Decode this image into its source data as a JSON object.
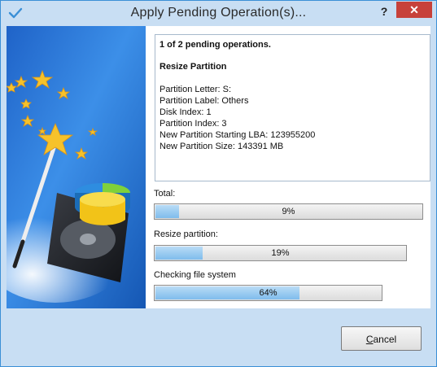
{
  "window": {
    "title": "Apply Pending Operation(s)...",
    "help_label": "?",
    "close_label": "✕"
  },
  "info": {
    "summary": "1 of 2 pending operations.",
    "operation": "Resize Partition",
    "details": [
      "Partition Letter: S:",
      "Partition Label: Others",
      "Disk Index: 1",
      "Partition Index: 3",
      "New Partition Starting LBA: 123955200",
      "New Partition Size: 143391 MB"
    ]
  },
  "progress": [
    {
      "label": "Total:",
      "percent_text": "9%",
      "value": 0.09
    },
    {
      "label": "Resize partition:",
      "percent_text": "19%",
      "value": 0.19
    },
    {
      "label": "Checking file system",
      "percent_text": "64%",
      "value": 0.64
    }
  ],
  "footer": {
    "cancel_first": "C",
    "cancel_rest": "ancel"
  },
  "colors": {
    "titlebar_bg": "#c8def3",
    "close_bg": "#c7413a",
    "progress_fill": "#7fbcec"
  }
}
